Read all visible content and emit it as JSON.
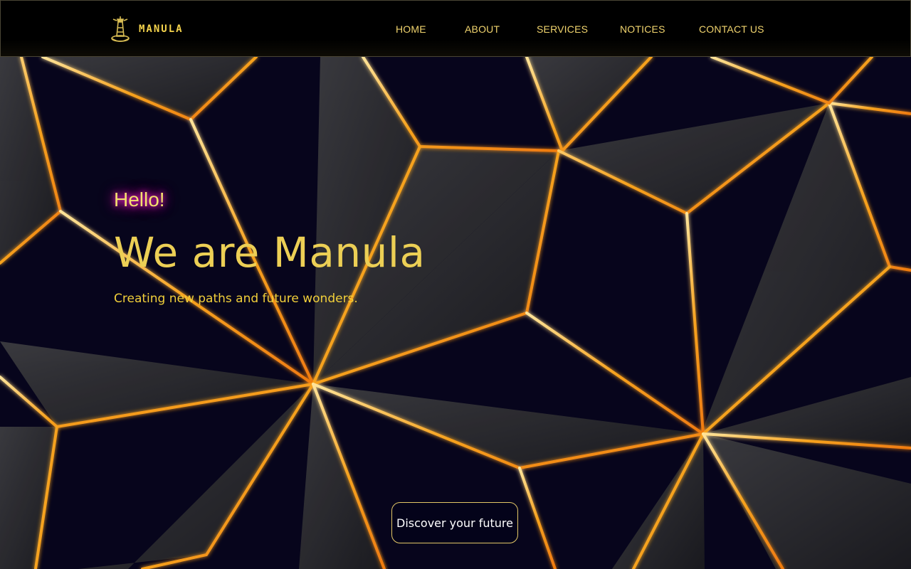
{
  "brand": {
    "name": "MANULA",
    "logo_icon": "lighthouse-icon",
    "color": "#f4d34c"
  },
  "nav": {
    "items": [
      {
        "label": "HOME"
      },
      {
        "label": "ABOUT"
      },
      {
        "label": "SERVICES"
      },
      {
        "label": "NOTICES"
      },
      {
        "label": "CONTACT US"
      }
    ]
  },
  "hero": {
    "greeting": "Hello!",
    "headline": "We are Manula",
    "tagline": "Creating new paths and future wonders.",
    "cta_label": "Discover your future"
  },
  "colors": {
    "accent_gold": "#f1cf3a",
    "background_navy": "#07051c",
    "greeting_glow": "#ff2bd6",
    "line_orange": "#f28a12"
  }
}
